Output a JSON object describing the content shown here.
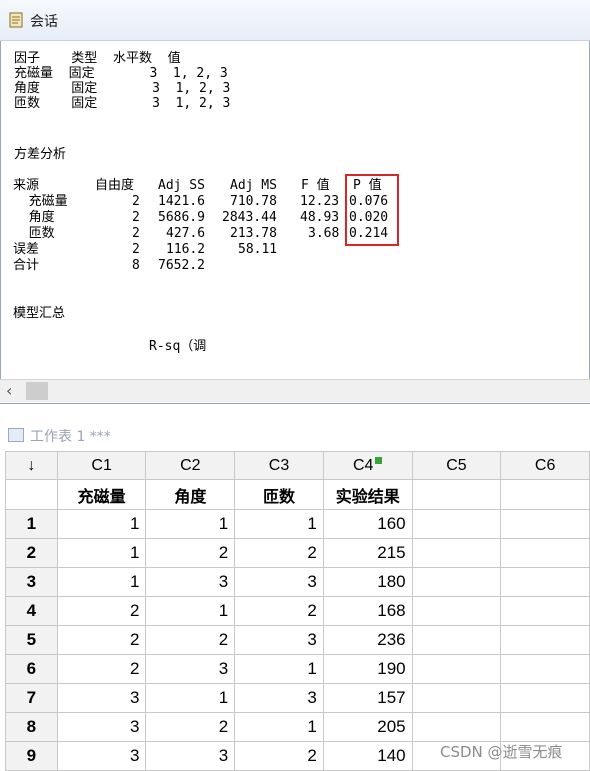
{
  "session": {
    "title": "会话",
    "factors": {
      "header": "因子    类型  水平数  值",
      "rows": [
        "充磁量  固定       3  1, 2, 3",
        "角度    固定       3  1, 2, 3",
        "匝数    固定       3  1, 2, 3"
      ]
    },
    "anova_title": "方差分析",
    "anova_header": [
      "来源",
      "自由度",
      "Adj SS",
      "Adj MS",
      "F 值",
      "P 值"
    ],
    "anova_rows": [
      {
        "source": "  充磁量",
        "df": "2",
        "ss": "1421.6",
        "ms": "710.78",
        "f": "12.23",
        "p": "0.076"
      },
      {
        "source": "  角度",
        "df": "2",
        "ss": "5686.9",
        "ms": "2843.44",
        "f": "48.93",
        "p": "0.020"
      },
      {
        "source": "  匝数",
        "df": "2",
        "ss": "427.6",
        "ms": "213.78",
        "f": "3.68",
        "p": "0.214"
      },
      {
        "source": "误差",
        "df": "2",
        "ss": "116.2",
        "ms": "58.11",
        "f": "",
        "p": ""
      },
      {
        "source": "合计",
        "df": "8",
        "ss": "7652.2",
        "ms": "",
        "f": "",
        "p": ""
      }
    ],
    "model_title": "模型汇总",
    "model_line": "R-sq（调"
  },
  "worksheet": {
    "title": "工作表 1 ***",
    "corner": "↓",
    "columns": [
      "C1",
      "C2",
      "C3",
      "C4",
      "C5",
      "C6"
    ],
    "names": [
      "充磁量",
      "角度",
      "匝数",
      "实验结果",
      "",
      ""
    ],
    "rows": [
      [
        "1",
        "1",
        "1",
        "1",
        "160"
      ],
      [
        "2",
        "1",
        "2",
        "2",
        "215"
      ],
      [
        "3",
        "1",
        "3",
        "3",
        "180"
      ],
      [
        "4",
        "2",
        "1",
        "2",
        "168"
      ],
      [
        "5",
        "2",
        "2",
        "3",
        "236"
      ],
      [
        "6",
        "2",
        "3",
        "1",
        "190"
      ],
      [
        "7",
        "3",
        "1",
        "3",
        "157"
      ],
      [
        "8",
        "3",
        "2",
        "1",
        "205"
      ],
      [
        "9",
        "3",
        "3",
        "2",
        "140"
      ]
    ]
  },
  "watermark": "CSDN @逝雪无痕",
  "colors": {
    "highlight_box": "#d6262b",
    "header_bg": "#f2f2f2"
  }
}
